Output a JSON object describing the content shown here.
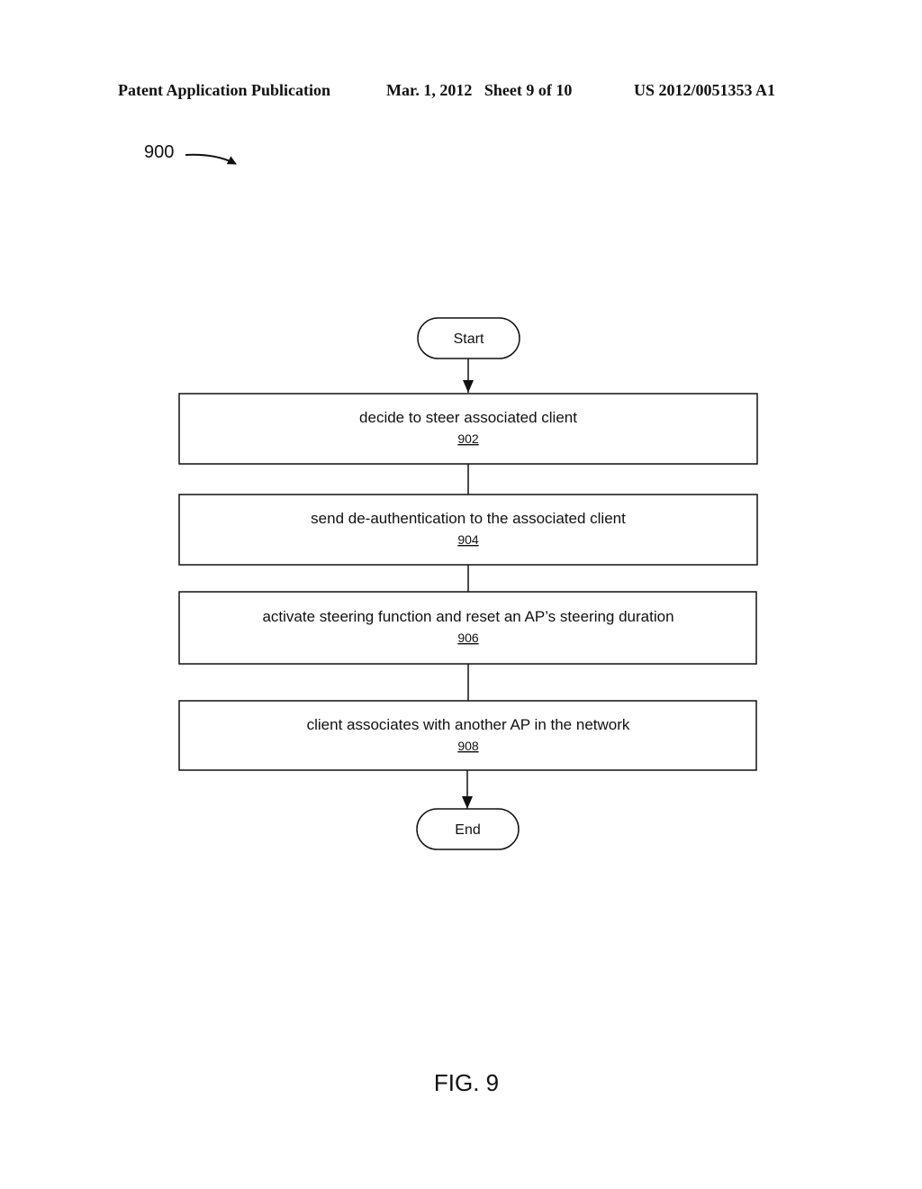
{
  "header": {
    "publication": "Patent Application Publication",
    "date_sheet": "Mar. 1, 2012   Sheet 9 of 10",
    "patent_number": "US 2012/0051353 A1"
  },
  "figure_ref": "900",
  "flowchart": {
    "start_label": "Start",
    "end_label": "End",
    "steps": [
      {
        "text": "decide to steer associated client",
        "ref": "902"
      },
      {
        "text": "send de-authentication to the associated client",
        "ref": "904"
      },
      {
        "text": "activate steering function and reset an AP’s steering duration",
        "ref": "906"
      },
      {
        "text": "client associates with another AP in the network",
        "ref": "908"
      }
    ]
  },
  "figure_label": "FIG. 9"
}
